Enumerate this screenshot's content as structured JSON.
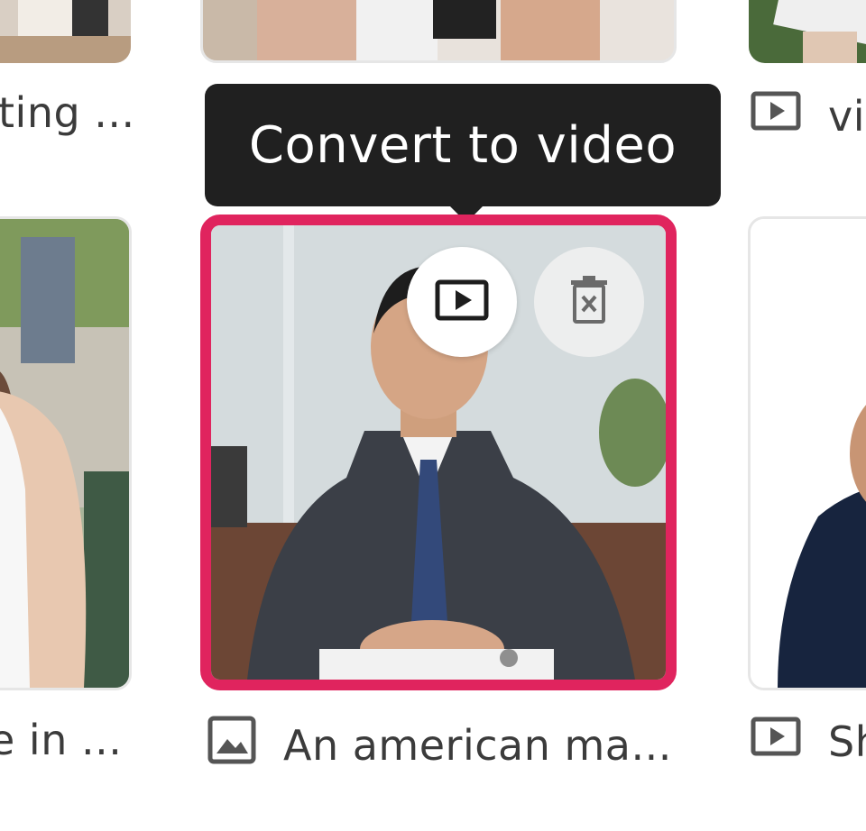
{
  "tooltip": {
    "text": "Convert to video"
  },
  "cards": {
    "top_left_label": "ting ...",
    "top_right_label": "vi",
    "bottom_left_label": "e in ...",
    "selected_label": "An american ma...",
    "bottom_right_label": "Sh"
  },
  "buttons": {
    "convert_icon": "play-square-icon",
    "delete_icon": "delete-icon"
  },
  "colors": {
    "accent": "#e0245e",
    "tooltip_bg": "#202020"
  }
}
